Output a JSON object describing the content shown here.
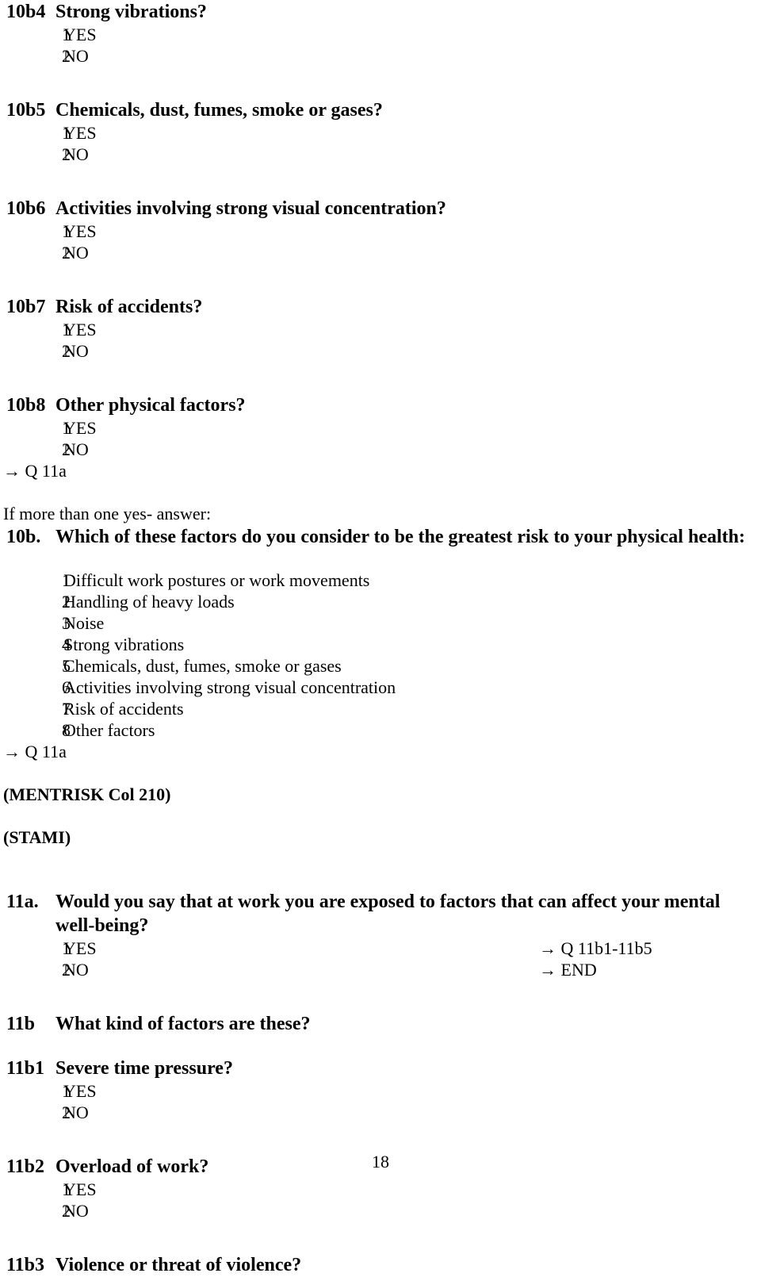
{
  "document": {
    "page_number": "18",
    "answer_options": {
      "yes_num": "1",
      "yes_label": "YES",
      "no_num": "2",
      "no_label": "NO"
    }
  },
  "questions": [
    {
      "label": "10b4",
      "text": "Strong vibrations?"
    },
    {
      "label": "10b5",
      "text": "Chemicals, dust, fumes, smoke or gases?"
    },
    {
      "label": "10b6",
      "text": "Activities involving strong visual concentration?"
    },
    {
      "label": "10b7",
      "text": "Risk of accidents?"
    },
    {
      "label": "10b8",
      "text": "Other physical factors?"
    }
  ],
  "route_after_10b8": "→ Q 11a",
  "instruction_10b": "If more than one yes- answer:",
  "question_10b": {
    "label": "10b.",
    "text": "Which of these factors do you consider to be the greatest risk to your physical health:"
  },
  "factor_list": [
    {
      "num": "1",
      "text": "Difficult work postures or work movements"
    },
    {
      "num": "2",
      "text": "Handling of heavy loads"
    },
    {
      "num": "3",
      "text": "Noise"
    },
    {
      "num": "4",
      "text": "Strong vibrations"
    },
    {
      "num": "5",
      "text": "Chemicals, dust, fumes, smoke or gases"
    },
    {
      "num": "6",
      "text": "Activities involving strong visual concentration"
    },
    {
      "num": "7",
      "text": "Risk of accidents"
    },
    {
      "num": "8",
      "text": "Other factors"
    }
  ],
  "route_after_list": "→ Q 11a",
  "annotations": {
    "mentrisk": "(MENTRISK Col 210)",
    "stami": "(STAMI)"
  },
  "question_11a": {
    "label": "11a.",
    "text": "Would you say that at work you are exposed to factors that can affect your mental well-being?",
    "yes_route": "→ Q 11b1-11b5",
    "no_route": "→ END"
  },
  "question_11b": {
    "label": "11b",
    "text": "What kind of factors are these?"
  },
  "questions_11b_sub": [
    {
      "label": "11b1",
      "text": "Severe time pressure?"
    },
    {
      "label": "11b2",
      "text": "Overload of work?"
    }
  ],
  "question_11b3": {
    "label": "11b3",
    "text": "Violence or threat of violence?"
  }
}
